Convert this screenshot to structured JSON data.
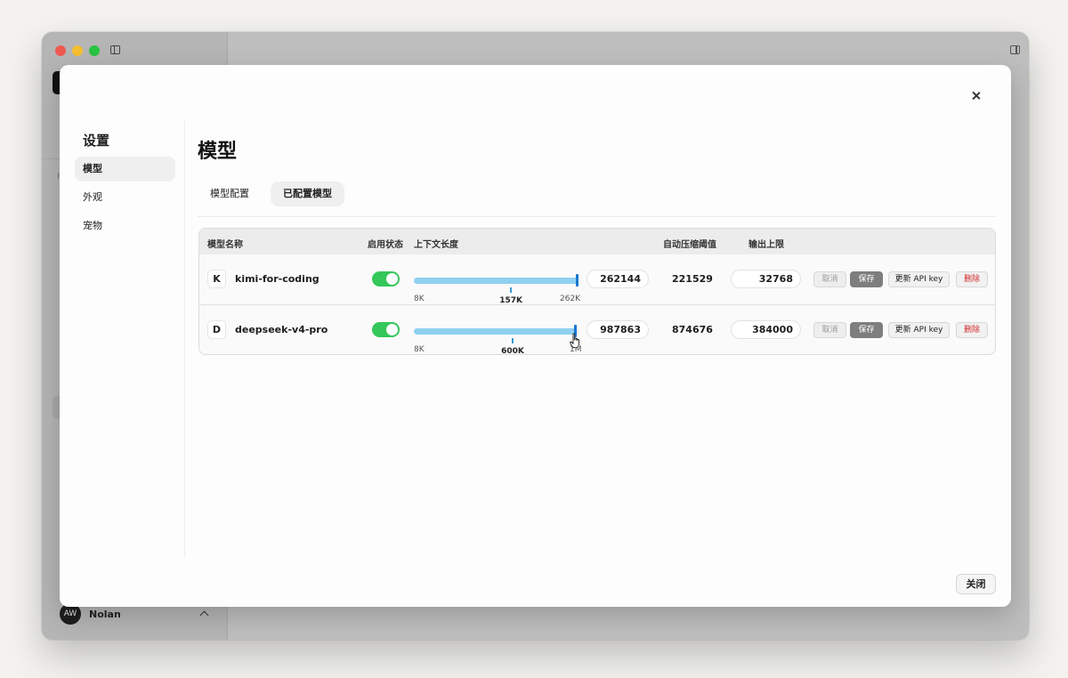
{
  "app": {
    "user": {
      "initials": "AW",
      "name": "Nolan"
    },
    "faint_label": "P"
  },
  "settings": {
    "title": "设置",
    "nav": [
      "模型",
      "外观",
      "宠物"
    ],
    "active_nav": "模型"
  },
  "page": {
    "title": "模型",
    "tabs": [
      "模型配置",
      "已配置模型"
    ],
    "active_tab": "已配置模型"
  },
  "table": {
    "headers": {
      "name": "模型名称",
      "enabled": "启用状态",
      "context": "上下文长度",
      "compress": "自动压缩阈值",
      "output": "输出上限"
    },
    "rows": [
      {
        "badge": "K",
        "name": "kimi-for-coding",
        "enabled": true,
        "context_value": "262144",
        "slider_min": "8K",
        "slider_rec": "157K",
        "slider_max": "262K",
        "slider_fraction": 1.0,
        "rec_fraction": 0.59,
        "compress": "221529",
        "output": "32768"
      },
      {
        "badge": "D",
        "name": "deepseek-v4-pro",
        "enabled": true,
        "context_value": "987863",
        "slider_min": "8K",
        "slider_rec": "600K",
        "slider_max": "1M",
        "slider_fraction": 0.988,
        "rec_fraction": 0.6,
        "compress": "874676",
        "output": "384000"
      }
    ],
    "actions": {
      "cancel": "取消",
      "save": "保存",
      "api_key": "更新 API key",
      "delete": "删除"
    }
  },
  "footer": {
    "close": "关闭"
  },
  "colors": {
    "toggle_on": "#34c759",
    "slider_fill": "#8fd0f0",
    "slider_thumb": "#1876cf",
    "delete_text": "#d22b2b"
  }
}
